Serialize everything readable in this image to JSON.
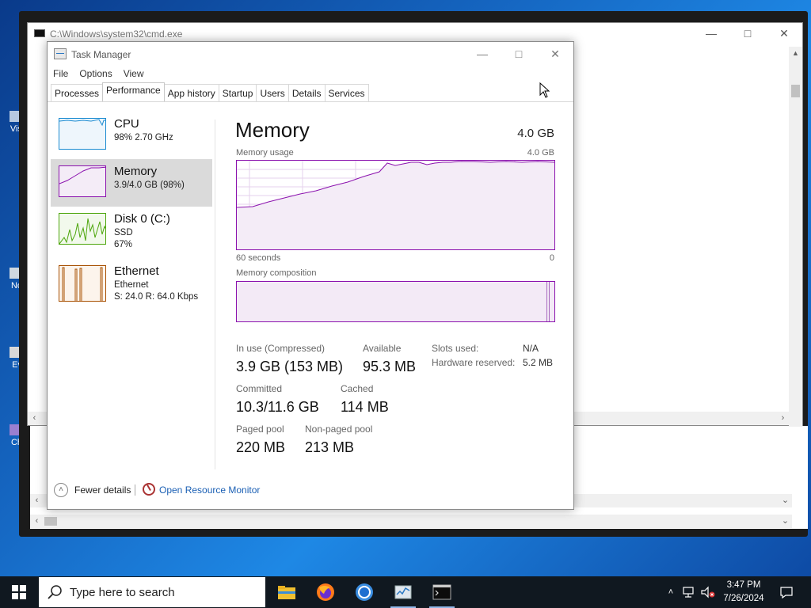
{
  "desktop": {
    "icons": [
      "Vis",
      "No",
      "Ev",
      "Ch"
    ]
  },
  "cmd_window": {
    "title": "C:\\Windows\\system32\\cmd.exe"
  },
  "task_manager": {
    "title": "Task Manager",
    "menu": [
      "File",
      "Options",
      "View"
    ],
    "tabs": [
      "Processes",
      "Performance",
      "App history",
      "Startup",
      "Users",
      "Details",
      "Services"
    ],
    "active_tab": "Performance",
    "sidebar": [
      {
        "title": "CPU",
        "line1": "98%  2.70 GHz",
        "line2": "",
        "color": "#1b8bd1"
      },
      {
        "title": "Memory",
        "line1": "3.9/4.0 GB (98%)",
        "line2": "",
        "color": "#8b12ae"
      },
      {
        "title": "Disk 0 (C:)",
        "line1": "SSD",
        "line2": "67%",
        "color": "#4da60c"
      },
      {
        "title": "Ethernet",
        "line1": "Ethernet",
        "line2": "S: 24.0  R: 64.0 Kbps",
        "color": "#a74f01"
      }
    ],
    "selected_item": "Memory",
    "memory": {
      "heading": "Memory",
      "total": "4.0 GB",
      "usage_label": "Memory usage",
      "usage_max": "4.0 GB",
      "time_left": "60 seconds",
      "time_right": "0",
      "composition_label": "Memory composition",
      "usage_percent": 98,
      "stats": {
        "in_use_label": "In use (Compressed)",
        "in_use_value": "3.9 GB (153 MB)",
        "available_label": "Available",
        "available_value": "95.3 MB",
        "committed_label": "Committed",
        "committed_value": "10.3/11.6 GB",
        "cached_label": "Cached",
        "cached_value": "114 MB",
        "paged_label": "Paged pool",
        "paged_value": "220 MB",
        "nonpaged_label": "Non-paged pool",
        "nonpaged_value": "213 MB",
        "slots_label": "Slots used:",
        "slots_value": "N/A",
        "hw_reserved_label": "Hardware reserved:",
        "hw_reserved_value": "5.2 MB"
      }
    },
    "footer": {
      "fewer_details": "Fewer details",
      "resource_monitor": "Open Resource Monitor"
    }
  },
  "taskbar": {
    "search_placeholder": "Type here to search",
    "apps": [
      "file-explorer-icon",
      "firefox-icon",
      "chrome-icon",
      "task-manager-icon",
      "cmd-icon"
    ],
    "time": "3:47 PM",
    "date": "7/26/2024"
  },
  "colors": {
    "memory_accent": "#8b12ae",
    "cpu_accent": "#1b8bd1",
    "disk_accent": "#4da60c",
    "ethernet_accent": "#a74f01",
    "link": "#1a5fb4"
  }
}
